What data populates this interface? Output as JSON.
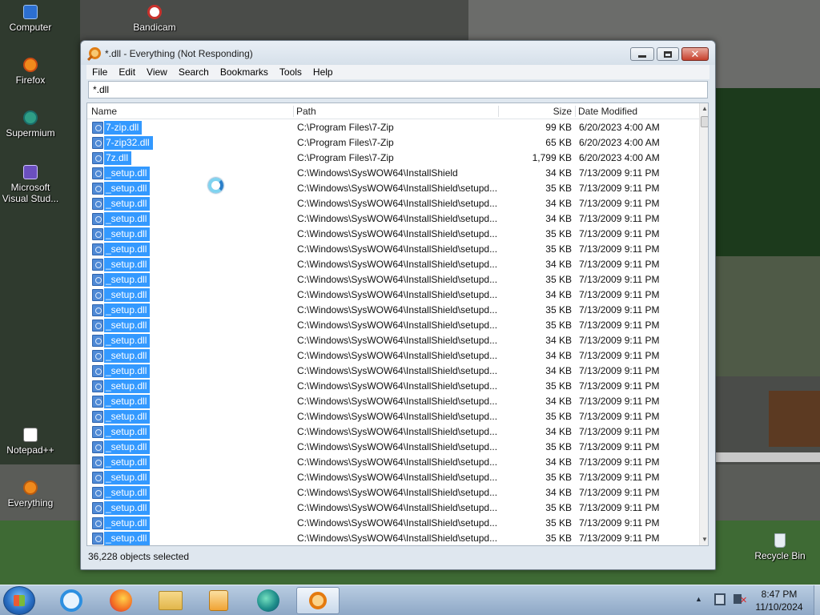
{
  "desktop": {
    "icons": [
      {
        "label": "Computer",
        "icon": "computer-icon"
      },
      {
        "label": "Bandicam",
        "icon": "bandicam-icon"
      },
      {
        "label": "Firefox",
        "icon": "firefox-icon"
      },
      {
        "label": "Supermium",
        "icon": "supermium-icon"
      },
      {
        "label": "Microsoft Visual Stud...",
        "icon": "visual-studio-icon"
      },
      {
        "label": "Notepad++",
        "icon": "notepad-plus-plus-icon"
      },
      {
        "label": "Everything",
        "icon": "everything-icon"
      },
      {
        "label": "Recycle Bin",
        "icon": "recycle-bin-icon"
      }
    ]
  },
  "window": {
    "title": "*.dll - Everything (Not Responding)",
    "menu": [
      "File",
      "Edit",
      "View",
      "Search",
      "Bookmarks",
      "Tools",
      "Help"
    ],
    "search_value": "*.dll",
    "columns": {
      "name": "Name",
      "path": "Path",
      "size": "Size",
      "date": "Date Modified"
    },
    "rows": [
      {
        "name": "7-zip.dll",
        "path": "C:\\Program Files\\7-Zip",
        "size": "99 KB",
        "date": "6/20/2023 4:00 AM"
      },
      {
        "name": "7-zip32.dll",
        "path": "C:\\Program Files\\7-Zip",
        "size": "65 KB",
        "date": "6/20/2023 4:00 AM"
      },
      {
        "name": "7z.dll",
        "path": "C:\\Program Files\\7-Zip",
        "size": "1,799 KB",
        "date": "6/20/2023 4:00 AM"
      },
      {
        "name": "_setup.dll",
        "path": "C:\\Windows\\SysWOW64\\InstallShield",
        "size": "34 KB",
        "date": "7/13/2009 9:11 PM"
      },
      {
        "name": "_setup.dll",
        "path": "C:\\Windows\\SysWOW64\\InstallShield\\setupd...",
        "size": "35 KB",
        "date": "7/13/2009 9:11 PM"
      },
      {
        "name": "_setup.dll",
        "path": "C:\\Windows\\SysWOW64\\InstallShield\\setupd...",
        "size": "34 KB",
        "date": "7/13/2009 9:11 PM"
      },
      {
        "name": "_setup.dll",
        "path": "C:\\Windows\\SysWOW64\\InstallShield\\setupd...",
        "size": "34 KB",
        "date": "7/13/2009 9:11 PM"
      },
      {
        "name": "_setup.dll",
        "path": "C:\\Windows\\SysWOW64\\InstallShield\\setupd...",
        "size": "35 KB",
        "date": "7/13/2009 9:11 PM"
      },
      {
        "name": "_setup.dll",
        "path": "C:\\Windows\\SysWOW64\\InstallShield\\setupd...",
        "size": "35 KB",
        "date": "7/13/2009 9:11 PM"
      },
      {
        "name": "_setup.dll",
        "path": "C:\\Windows\\SysWOW64\\InstallShield\\setupd...",
        "size": "34 KB",
        "date": "7/13/2009 9:11 PM"
      },
      {
        "name": "_setup.dll",
        "path": "C:\\Windows\\SysWOW64\\InstallShield\\setupd...",
        "size": "35 KB",
        "date": "7/13/2009 9:11 PM"
      },
      {
        "name": "_setup.dll",
        "path": "C:\\Windows\\SysWOW64\\InstallShield\\setupd...",
        "size": "34 KB",
        "date": "7/13/2009 9:11 PM"
      },
      {
        "name": "_setup.dll",
        "path": "C:\\Windows\\SysWOW64\\InstallShield\\setupd...",
        "size": "35 KB",
        "date": "7/13/2009 9:11 PM"
      },
      {
        "name": "_setup.dll",
        "path": "C:\\Windows\\SysWOW64\\InstallShield\\setupd...",
        "size": "35 KB",
        "date": "7/13/2009 9:11 PM"
      },
      {
        "name": "_setup.dll",
        "path": "C:\\Windows\\SysWOW64\\InstallShield\\setupd...",
        "size": "34 KB",
        "date": "7/13/2009 9:11 PM"
      },
      {
        "name": "_setup.dll",
        "path": "C:\\Windows\\SysWOW64\\InstallShield\\setupd...",
        "size": "34 KB",
        "date": "7/13/2009 9:11 PM"
      },
      {
        "name": "_setup.dll",
        "path": "C:\\Windows\\SysWOW64\\InstallShield\\setupd...",
        "size": "34 KB",
        "date": "7/13/2009 9:11 PM"
      },
      {
        "name": "_setup.dll",
        "path": "C:\\Windows\\SysWOW64\\InstallShield\\setupd...",
        "size": "35 KB",
        "date": "7/13/2009 9:11 PM"
      },
      {
        "name": "_setup.dll",
        "path": "C:\\Windows\\SysWOW64\\InstallShield\\setupd...",
        "size": "34 KB",
        "date": "7/13/2009 9:11 PM"
      },
      {
        "name": "_setup.dll",
        "path": "C:\\Windows\\SysWOW64\\InstallShield\\setupd...",
        "size": "35 KB",
        "date": "7/13/2009 9:11 PM"
      },
      {
        "name": "_setup.dll",
        "path": "C:\\Windows\\SysWOW64\\InstallShield\\setupd...",
        "size": "34 KB",
        "date": "7/13/2009 9:11 PM"
      },
      {
        "name": "_setup.dll",
        "path": "C:\\Windows\\SysWOW64\\InstallShield\\setupd...",
        "size": "35 KB",
        "date": "7/13/2009 9:11 PM"
      },
      {
        "name": "_setup.dll",
        "path": "C:\\Windows\\SysWOW64\\InstallShield\\setupd...",
        "size": "34 KB",
        "date": "7/13/2009 9:11 PM"
      },
      {
        "name": "_setup.dll",
        "path": "C:\\Windows\\SysWOW64\\InstallShield\\setupd...",
        "size": "35 KB",
        "date": "7/13/2009 9:11 PM"
      },
      {
        "name": "_setup.dll",
        "path": "C:\\Windows\\SysWOW64\\InstallShield\\setupd...",
        "size": "34 KB",
        "date": "7/13/2009 9:11 PM"
      },
      {
        "name": "_setup.dll",
        "path": "C:\\Windows\\SysWOW64\\InstallShield\\setupd...",
        "size": "35 KB",
        "date": "7/13/2009 9:11 PM"
      },
      {
        "name": "_setup.dll",
        "path": "C:\\Windows\\SysWOW64\\InstallShield\\setupd...",
        "size": "35 KB",
        "date": "7/13/2009 9:11 PM"
      },
      {
        "name": "_setup.dll",
        "path": "C:\\Windows\\SysWOW64\\InstallShield\\setupd...",
        "size": "35 KB",
        "date": "7/13/2009 9:11 PM"
      },
      {
        "name": "_setup.dll",
        "path": "C:\\Windows\\SysWOW64\\InstallShield\\setupd...",
        "size": "34 KB",
        "date": "7/13/2009 9:11 PM"
      }
    ],
    "status": "36,228 objects selected"
  },
  "taskbar": {
    "apps": [
      "internet-explorer-icon",
      "firefox-icon",
      "file-explorer-icon",
      "media-player-icon",
      "edge-icon",
      "everything-icon"
    ],
    "clock_time": "8:47 PM",
    "clock_date": "11/10/2024"
  },
  "colors": {
    "selection": "#3399ff",
    "window_frame": "#dfe7ef",
    "close_button": "#c7402c"
  }
}
